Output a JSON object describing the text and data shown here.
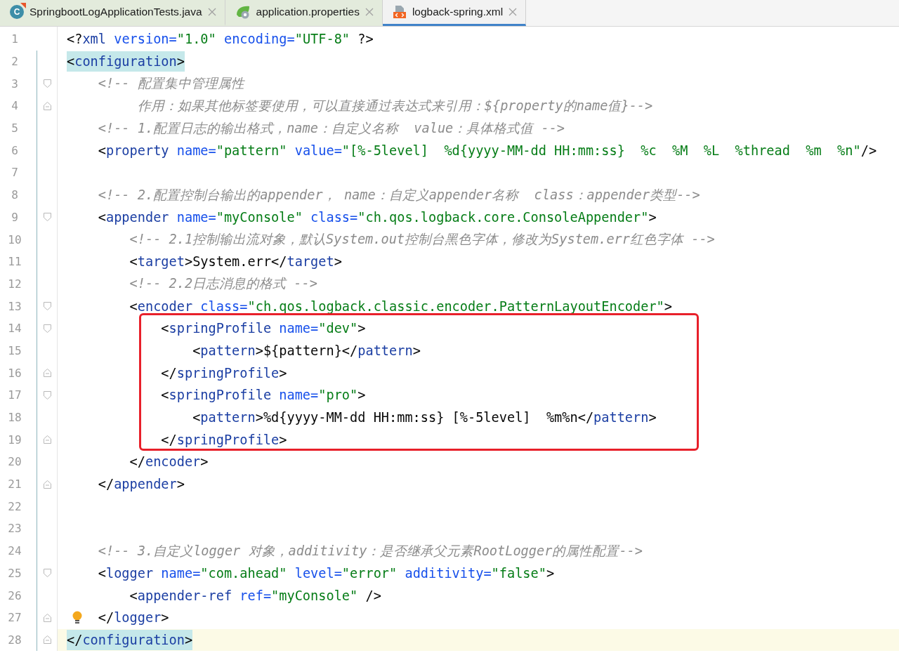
{
  "tabs": [
    {
      "label": "SpringbootLogApplicationTests.java",
      "kind": "java",
      "icon_letter": "C",
      "selected": false
    },
    {
      "label": "application.properties",
      "kind": "properties",
      "selected": false
    },
    {
      "label": "logback-spring.xml",
      "kind": "xml",
      "selected": true
    }
  ],
  "editor": {
    "lines": [
      {
        "number": "1",
        "kind": "code",
        "text": "<?xml version=\"1.0\" encoding=\"UTF-8\" ?>"
      },
      {
        "number": "2",
        "kind": "code",
        "text": "<configuration>",
        "matched": true
      },
      {
        "number": "3",
        "kind": "comment",
        "text": "    <!-- 配置集中管理属性",
        "fold_open": true
      },
      {
        "number": "4",
        "kind": "comment",
        "text": "         作用：如果其他标签要使用，可以直接通过表达式来引用：${property的name值}-->",
        "fold_close": true
      },
      {
        "number": "5",
        "kind": "comment",
        "text": "    <!-- 1.配置日志的输出格式，name：自定义名称  value：具体格式值 -->"
      },
      {
        "number": "6",
        "kind": "code",
        "text": "    <property name=\"pattern\" value=\"[%-5level]  %d{yyyy-MM-dd HH:mm:ss}  %c  %M  %L  %thread  %m  %n\"/>"
      },
      {
        "number": "7"
      },
      {
        "number": "8",
        "kind": "comment",
        "text": "    <!-- 2.配置控制台输出的appender， name：自定义appender名称  class：appender类型-->"
      },
      {
        "number": "9",
        "kind": "code",
        "text": "    <appender name=\"myConsole\" class=\"ch.qos.logback.core.ConsoleAppender\">",
        "fold_open": true
      },
      {
        "number": "10",
        "kind": "comment",
        "text": "        <!-- 2.1控制输出流对象，默认System.out控制台黑色字体，修改为System.err红色字体 -->"
      },
      {
        "number": "11",
        "kind": "code",
        "text": "        <target>System.err</target>"
      },
      {
        "number": "12",
        "kind": "comment",
        "text": "        <!-- 2.2日志消息的格式 -->"
      },
      {
        "number": "13",
        "kind": "code",
        "text": "        <encoder class=\"ch.qos.logback.classic.encoder.PatternLayoutEncoder\">",
        "fold_open": true
      },
      {
        "number": "14",
        "kind": "code",
        "text": "            <springProfile name=\"dev\">",
        "fold_open": true,
        "framed": true
      },
      {
        "number": "15",
        "kind": "code",
        "text": "                <pattern>${pattern}</pattern>",
        "framed": true
      },
      {
        "number": "16",
        "kind": "code",
        "text": "            </springProfile>",
        "fold_close": true,
        "framed": true
      },
      {
        "number": "17",
        "kind": "code",
        "text": "            <springProfile name=\"pro\">",
        "fold_open": true,
        "framed": true
      },
      {
        "number": "18",
        "kind": "code",
        "text": "                <pattern>%d{yyyy-MM-dd HH:mm:ss} [%-5level]  %m%n</pattern>",
        "framed": true
      },
      {
        "number": "19",
        "kind": "code",
        "text": "            </springProfile>",
        "fold_close": true,
        "framed": true
      },
      {
        "number": "20",
        "kind": "code",
        "text": "        </encoder>"
      },
      {
        "number": "21",
        "kind": "code",
        "text": "    </appender>",
        "fold_close": true
      },
      {
        "number": "22"
      },
      {
        "number": "23"
      },
      {
        "number": "24",
        "kind": "comment",
        "text": "    <!-- 3.自定义logger 对象，additivity：是否继承父元素RootLogger的属性配置-->"
      },
      {
        "number": "25",
        "kind": "code",
        "text": "    <logger name=\"com.ahead\" level=\"error\" additivity=\"false\">",
        "fold_open": true
      },
      {
        "number": "26",
        "kind": "code",
        "text": "        <appender-ref ref=\"myConsole\" />"
      },
      {
        "number": "27",
        "kind": "code",
        "text": "    </logger>",
        "fold_close": true,
        "bulb": true
      },
      {
        "number": "28",
        "kind": "code",
        "text": "</configuration>",
        "fold_close": true,
        "matched": true,
        "current": true
      }
    ]
  }
}
